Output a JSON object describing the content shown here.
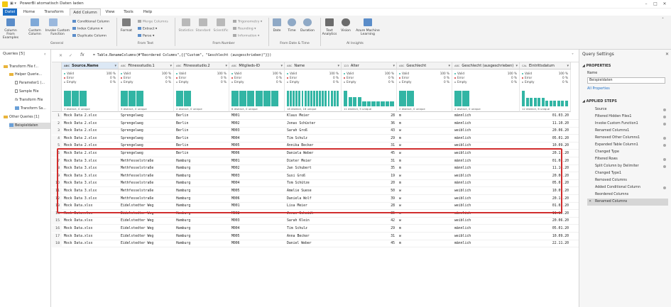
{
  "titlebar": {
    "title": "PowerBi atomatisch Daten laden"
  },
  "tabs": [
    {
      "label": "Datei"
    },
    {
      "label": "Home"
    },
    {
      "label": "Transform"
    },
    {
      "label": "Add Column"
    },
    {
      "label": "View"
    },
    {
      "label": "Tools"
    },
    {
      "label": "Help"
    }
  ],
  "ribbon": {
    "general": {
      "group": "General",
      "column_from_examples": "Column From Examples",
      "custom_column": "Custom Column",
      "invoke_custom_function": "Invoke Custom Function",
      "conditional_column": "Conditional Column",
      "index_column": "Index Column",
      "duplicate_column": "Duplicate Column"
    },
    "from_text": {
      "group": "From Text",
      "format": "Format",
      "merge_columns": "Merge Columns",
      "extract": "Extract",
      "parse": "Parse"
    },
    "from_number": {
      "group": "From Number",
      "statistics": "Statistics",
      "standard": "Standard",
      "scientific": "Scientific",
      "trigonometry": "Trigonometry",
      "rounding": "Rounding",
      "information": "Information"
    },
    "from_date": {
      "group": "From Date & Time",
      "date": "Date",
      "time": "Time",
      "duration": "Duration"
    },
    "ai": {
      "group": "AI Insights",
      "text_analytics": "Text Analytics",
      "vision": "Vision",
      "azure_ml": "Azure Machine Learning"
    }
  },
  "queries": {
    "header": "Queries [5]",
    "items": [
      {
        "label": "Transform File f...",
        "type": "folder",
        "indent": 0
      },
      {
        "label": "Helper Querie...",
        "type": "folder",
        "indent": 1
      },
      {
        "label": "Parameter1 (...",
        "type": "file",
        "indent": 2
      },
      {
        "label": "Sample File",
        "type": "file",
        "indent": 2
      },
      {
        "label": "Transform File",
        "type": "fx",
        "indent": 2
      },
      {
        "label": "Transform Sa...",
        "type": "table",
        "indent": 2
      },
      {
        "label": "Other Queries [1]",
        "type": "folder",
        "indent": 0
      },
      {
        "label": "Beispieldaten",
        "type": "table",
        "indent": 1,
        "selected": true
      }
    ]
  },
  "formula": {
    "text": "= Table.RenameColumns(#\"Reordered Columns\",{{\"Custom\", \"Geschlecht (ausgeschrieben)\"}})",
    "fx": "fx"
  },
  "columns": [
    {
      "name": "Source.Name",
      "type": "ABC",
      "valid": "100 %",
      "error": "0 %",
      "empty": "0 %",
      "distinct": "3 distinct, 0 unique",
      "hist": [
        1,
        1,
        1
      ],
      "selected": true
    },
    {
      "name": "Fitnessstudio.1",
      "type": "ABC",
      "valid": "100 %",
      "error": "0 %",
      "empty": "0 %",
      "distinct": "3 distinct, 0 unique",
      "hist": [
        1,
        1,
        1
      ]
    },
    {
      "name": "Fitnessstudio.2",
      "type": "ABC",
      "valid": "100 %",
      "error": "0 %",
      "empty": "0 %",
      "distinct": "2 distinct, 0 unique",
      "hist": [
        1,
        1
      ]
    },
    {
      "name": "Mitglieds-ID",
      "type": "ABC",
      "valid": "100 %",
      "error": "0 %",
      "empty": "0 %",
      "distinct": "6 distinct, 0 unique",
      "hist": [
        1,
        1,
        1,
        1,
        1,
        1
      ]
    },
    {
      "name": "Name",
      "type": "ABC",
      "valid": "100 %",
      "error": "0 %",
      "empty": "0 %",
      "distinct": "18 distinct, 18 unique",
      "hist": [
        1,
        1,
        1,
        1,
        1,
        1,
        1,
        1,
        1,
        1,
        1,
        1,
        1,
        1,
        1,
        1,
        1,
        1
      ]
    },
    {
      "name": "Alter",
      "type": "123",
      "valid": "100 %",
      "error": "0 %",
      "empty": "0 %",
      "distinct": "11 distinct, 5 unique",
      "hist": [
        1,
        0.6,
        0.6,
        0.6,
        0.3,
        0.3,
        0.3,
        0.3,
        0.3,
        0.3,
        0.3
      ]
    },
    {
      "name": "Geschlecht",
      "type": "ABC",
      "valid": "100 %",
      "error": "0 %",
      "empty": "0 %",
      "distinct": "2 distinct, 0 unique",
      "hist": [
        1,
        1
      ]
    },
    {
      "name": "Geschlecht (ausgeschrieben)",
      "type": "ABC",
      "valid": "100 %",
      "error": "0 %",
      "empty": "0 %",
      "distinct": "2 distinct, 0 unique",
      "hist": [
        1,
        1
      ]
    },
    {
      "name": "Eintrittsdatum",
      "type": "CAL",
      "valid": "100 %",
      "error": "0 %",
      "empty": "0 %",
      "distinct": "12 distinct, 6 unique",
      "hist": [
        1,
        0.55,
        0.55,
        0.55,
        0.55,
        0.55,
        0.35,
        0.35,
        0.35,
        0.35,
        0.35,
        0.35
      ]
    }
  ],
  "quality_labels": {
    "valid": "Valid",
    "error": "Error",
    "empty": "Empty"
  },
  "rows": [
    [
      "Mock Data 2.xlsx",
      "Sprengelweg",
      "Berlin",
      "M001",
      "Klaus Meier",
      "28",
      "m",
      "männlich",
      "01.03.20"
    ],
    [
      "Mock Data 2.xlsx",
      "Sprengelweg",
      "Berlin",
      "M002",
      "Jonas Schüster",
      "36",
      "m",
      "männlich",
      "11.10.20"
    ],
    [
      "Mock Data 2.xlsx",
      "Sprengelweg",
      "Berlin",
      "M003",
      "Sarah Groß",
      "43",
      "w",
      "weiblich",
      "20.06.20"
    ],
    [
      "Mock Data 2.xlsx",
      "Sprengelweg",
      "Berlin",
      "M004",
      "Tim Schulz",
      "29",
      "m",
      "männlich",
      "05.01.20"
    ],
    [
      "Mock Data 2.xlsx",
      "Sprengelweg",
      "Berlin",
      "M005",
      "Annika Becker",
      "31",
      "w",
      "weiblich",
      "10.09.20"
    ],
    [
      "Mock Data 2.xlsx",
      "Sprengelweg",
      "Berlin",
      "M006",
      "Daniela Weber",
      "45",
      "w",
      "weiblich",
      "20.11.20"
    ],
    [
      "Mock Data 3.xlsx",
      "Methfesselstraße",
      "Hamburg",
      "M001",
      "Dieter Meier",
      "31",
      "m",
      "männlich",
      "01.08.20"
    ],
    [
      "Mock Data 3.xlsx",
      "Methfesselstraße",
      "Hamburg",
      "M002",
      "Jan Schubert",
      "35",
      "m",
      "männlich",
      "11.10.20"
    ],
    [
      "Mock Data 3.xlsx",
      "Methfesselstraße",
      "Hamburg",
      "M003",
      "Susi Groß",
      "19",
      "w",
      "weiblich",
      "20.06.20"
    ],
    [
      "Mock Data 3.xlsx",
      "Methfesselstraße",
      "Hamburg",
      "M004",
      "Tom Schütze",
      "20",
      "m",
      "männlich",
      "05.01.20"
    ],
    [
      "Mock Data 3.xlsx",
      "Methfesselstraße",
      "Hamburg",
      "M005",
      "Amelie Suese",
      "50",
      "w",
      "weiblich",
      "10.09.20"
    ],
    [
      "Mock Data 3.xlsx",
      "Methfesselstraße",
      "Hamburg",
      "M006",
      "Daniela Wolf",
      "39",
      "w",
      "weiblich",
      "20.11.20"
    ],
    [
      "Mock Data.xlsx",
      "Eidelstedter Weg",
      "Hamburg",
      "M001",
      "Lisa Meier",
      "28",
      "w",
      "weiblich",
      "01.03.20"
    ],
    [
      "Mock Data.xlsx",
      "Eidelstedter Weg",
      "Hamburg",
      "M002",
      "Jonas Schmidt",
      "35",
      "m",
      "männlich",
      "11.10.20"
    ],
    [
      "Mock Data.xlsx",
      "Eidelstedter Weg",
      "Hamburg",
      "M003",
      "Sarah Klein",
      "42",
      "w",
      "weiblich",
      "20.06.20"
    ],
    [
      "Mock Data.xlsx",
      "Eidelstedter Weg",
      "Hamburg",
      "M004",
      "Tim Schulz",
      "29",
      "m",
      "männlich",
      "05.01.20"
    ],
    [
      "Mock Data.xlsx",
      "Eidelstedter Weg",
      "Hamburg",
      "M005",
      "Anna Becker",
      "31",
      "w",
      "weiblich",
      "10.09.20"
    ],
    [
      "Mock Data.xlsx",
      "Eidelstedter Weg",
      "Hamburg",
      "M006",
      "Daniel Weber",
      "45",
      "m",
      "männlich",
      "22.11.20"
    ]
  ],
  "settings": {
    "title": "Query Settings",
    "properties_header": "PROPERTIES",
    "name_label": "Name",
    "name_value": "Beispieldaten",
    "all_properties": "All Properties",
    "steps_header": "APPLIED STEPS",
    "steps": [
      {
        "label": "Source",
        "gear": true
      },
      {
        "label": "Filtered Hidden Files1",
        "gear": true
      },
      {
        "label": "Invoke Custom Function1",
        "gear": true
      },
      {
        "label": "Renamed Columns1",
        "gear": false
      },
      {
        "label": "Removed Other Columns1",
        "gear": true
      },
      {
        "label": "Expanded Table Column1",
        "gear": true
      },
      {
        "label": "Changed Type",
        "gear": false
      },
      {
        "label": "Filtered Rows",
        "gear": true
      },
      {
        "label": "Split Column by Delimiter",
        "gear": true
      },
      {
        "label": "Changed Type1",
        "gear": false
      },
      {
        "label": "Removed Columns",
        "gear": false
      },
      {
        "label": "Added Conditional Column",
        "gear": true
      },
      {
        "label": "Reordered Columns",
        "gear": false
      },
      {
        "label": "Renamed Columns",
        "gear": false,
        "selected": true
      }
    ]
  },
  "colors": {
    "accent": "#1f6fc5",
    "valid": "#32b5a4",
    "error": "#d12e2e",
    "empty": "#999999",
    "highlight": "#d12e2e"
  }
}
